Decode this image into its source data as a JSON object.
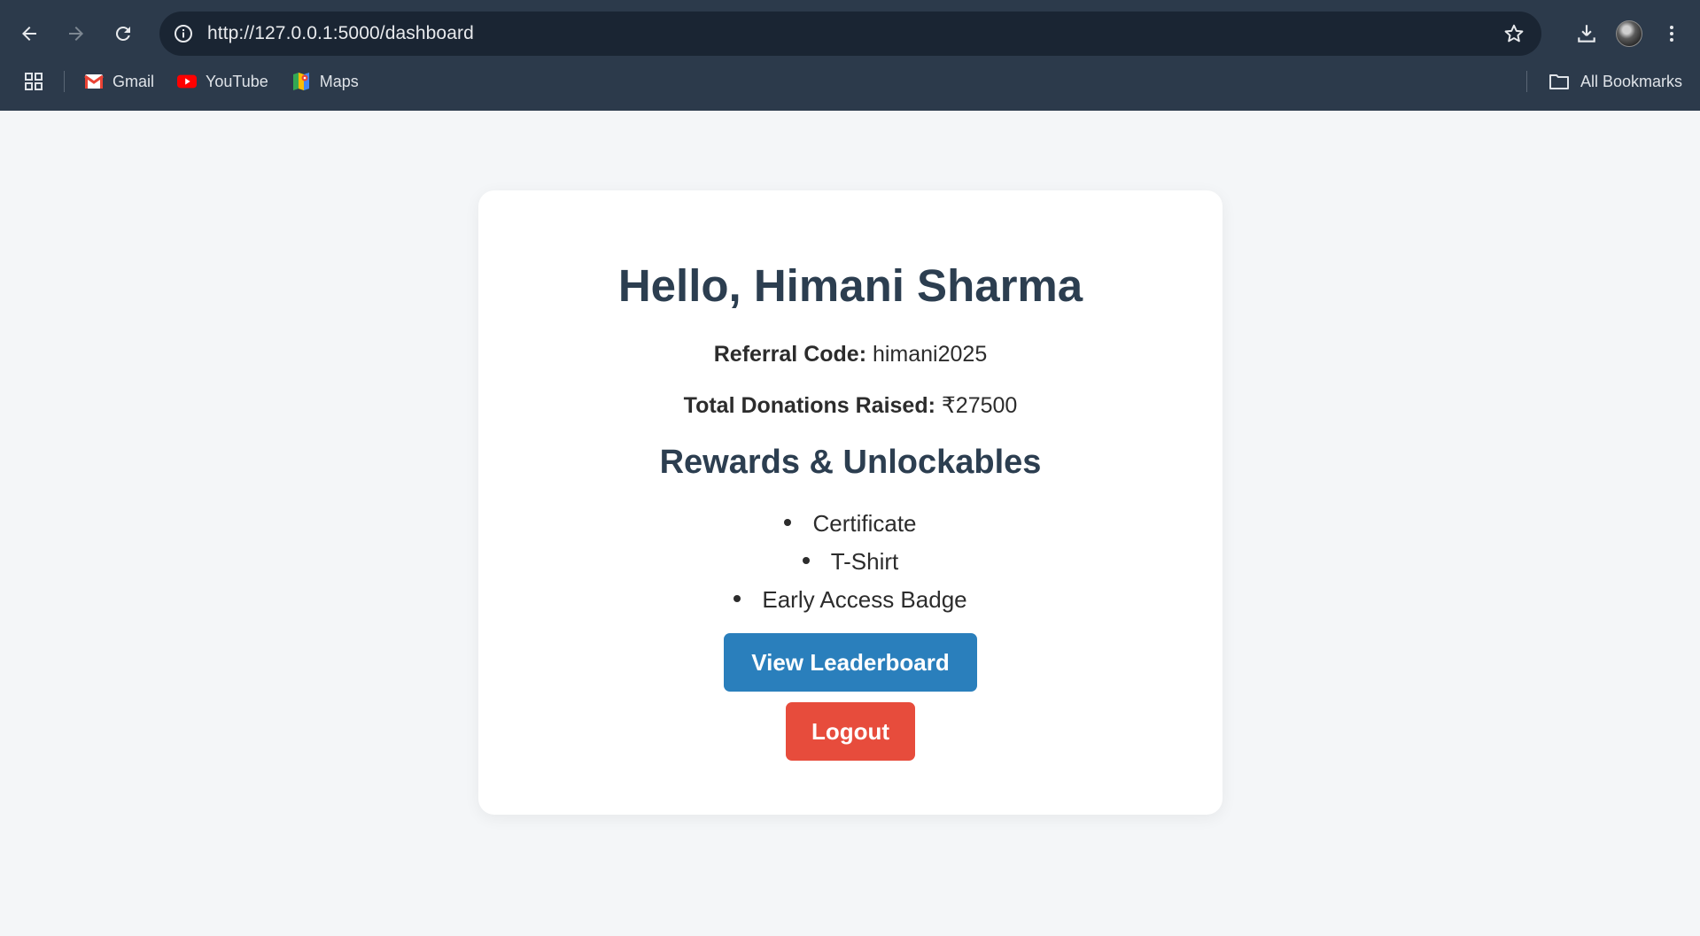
{
  "browser": {
    "url": "http://127.0.0.1:5000/dashboard",
    "bookmarks": [
      {
        "label": "Gmail",
        "icon": "gmail-icon"
      },
      {
        "label": "YouTube",
        "icon": "youtube-icon"
      },
      {
        "label": "Maps",
        "icon": "maps-icon"
      }
    ],
    "all_bookmarks": "All Bookmarks"
  },
  "dashboard": {
    "greeting": "Hello, Himani Sharma",
    "referral_label": "Referral Code:",
    "referral_code": "himani2025",
    "donations_label": "Total Donations Raised:",
    "donations_value": "₹27500",
    "rewards_title": "Rewards & Unlockables",
    "rewards": [
      "Certificate",
      "T-Shirt",
      "Early Access Badge"
    ],
    "leaderboard_button": "View Leaderboard",
    "logout_button": "Logout"
  },
  "colors": {
    "chrome_bg": "#2c3a4b",
    "omnibox_bg": "#1a2533",
    "page_bg": "#f4f6f8",
    "heading": "#2c3e50",
    "primary_button": "#2a7fbc",
    "danger_button": "#e74c3c"
  }
}
